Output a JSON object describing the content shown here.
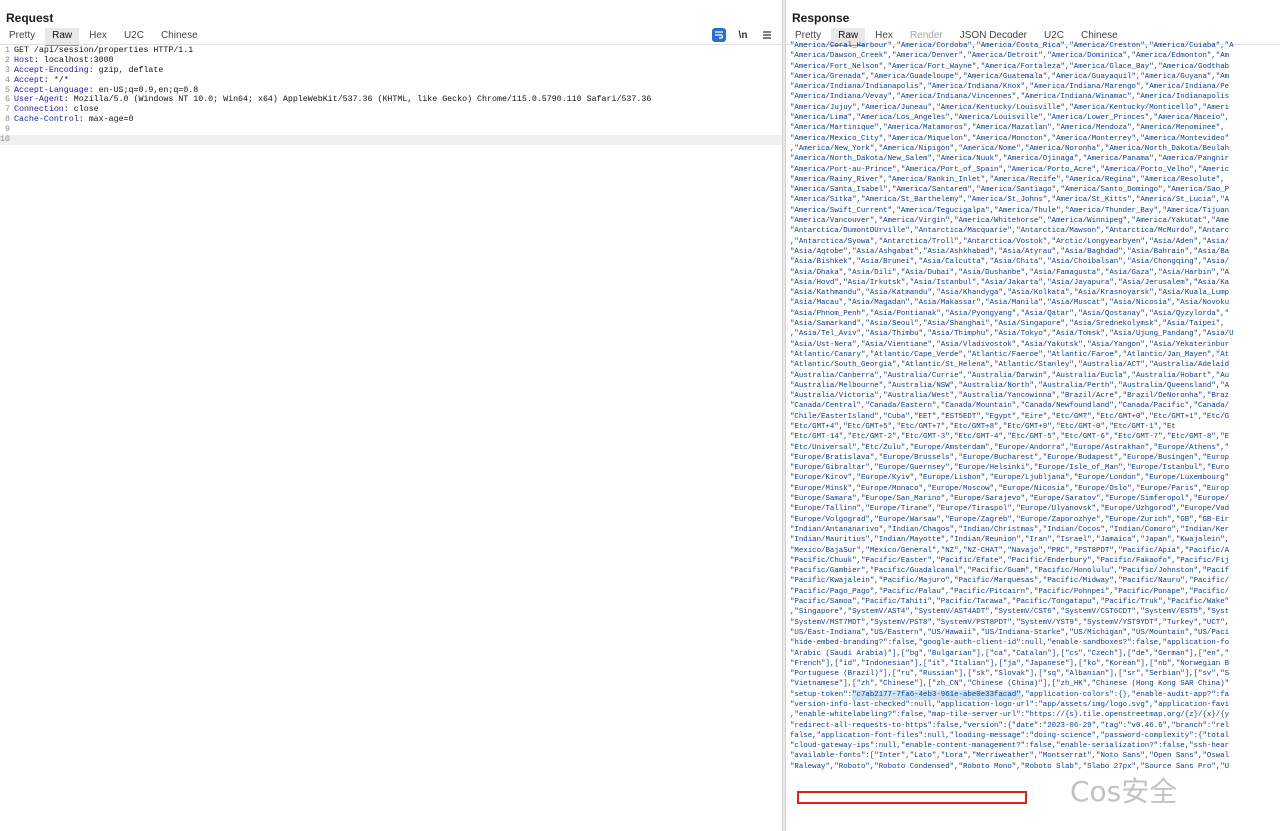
{
  "request": {
    "title": "Request",
    "tabs": [
      {
        "label": "Pretty",
        "active": false
      },
      {
        "label": "Raw",
        "active": true
      },
      {
        "label": "Hex",
        "active": false
      },
      {
        "label": "U2C",
        "active": false
      },
      {
        "label": "Chinese",
        "active": false
      }
    ],
    "toolbar": {
      "newline_label": "\\n"
    },
    "lines": [
      {
        "num": "1",
        "text": "GET /api/session/properties HTTP/1.1"
      },
      {
        "num": "2",
        "key": "Host",
        "value": ": localhost:3000"
      },
      {
        "num": "3",
        "key": "Accept-Encoding",
        "value": ": gzip, deflate"
      },
      {
        "num": "4",
        "key": "Accept",
        "value": ": */*"
      },
      {
        "num": "5",
        "key": "Accept-Language",
        "value": ": en-US;q=0.9,en;q=0.8"
      },
      {
        "num": "6",
        "key": "User-Agent",
        "value": ": Mozilla/5.0 (Windows NT 10.0; Win64; x64) AppleWebKit/537.36 (KHTML, like Gecko) Chrome/115.0.5790.110 Safari/537.36"
      },
      {
        "num": "7",
        "key": "Connection",
        "value": ": close"
      },
      {
        "num": "8",
        "key": "Cache-Control",
        "value": ": max-age=0"
      },
      {
        "num": "9",
        "text": ""
      },
      {
        "num": "10",
        "text": ""
      }
    ]
  },
  "response": {
    "title": "Response",
    "tabs": [
      {
        "label": "Pretty",
        "active": false
      },
      {
        "label": "Raw",
        "active": true
      },
      {
        "label": "Hex",
        "active": false
      },
      {
        "label": "Render",
        "active": false
      },
      {
        "label": "JSON Decoder",
        "active": false
      },
      {
        "label": "U2C",
        "active": false
      },
      {
        "label": "Chinese",
        "active": false
      }
    ],
    "lines": [
      "\"America/Coral_Harbour\",\"America/Cordoba\",\"America/Costa_Rica\",\"America/Creston\",\"America/Cuiaba\",\"A",
      "\"America/Dawson_Creek\",\"America/Denver\",\"America/Detroit\",\"America/Dominica\",\"America/Edmonton\",\"Am",
      "\"America/Fort_Nelson\",\"America/Fort_Wayne\",\"America/Fortaleza\",\"America/Glace_Bay\",\"America/Godthab",
      "\"America/Grenada\",\"America/Guadeloupe\",\"America/Guatemala\",\"America/Guayaquil\",\"America/Guyana\",\"Am",
      "\"America/Indiana/Indianapolis\",\"America/Indiana/Knox\",\"America/Indiana/Marengo\",\"America/Indiana/Pe",
      "\"America/Indiana/Vevay\",\"America/Indiana/Vincennes\",\"America/Indiana/Winamac\",\"America/Indianapolis",
      "\"America/Jujuy\",\"America/Juneau\",\"America/Kentucky/Louisville\",\"America/Kentucky/Monticello\",\"Ameri",
      "\"America/Lima\",\"America/Los_Angeles\",\"America/Louisville\",\"America/Lower_Princes\",\"America/Maceio\",",
      "\"America/Martinique\",\"America/Matamoros\",\"America/Mazatlan\",\"America/Mendoza\",\"America/Menominee\",",
      "\"America/Mexico_City\",\"America/Miquelon\",\"America/Moncton\",\"America/Monterrey\",\"America/Montevideo\"",
      ",\"America/New_York\",\"America/Nipigon\",\"America/Nome\",\"America/Noronha\",\"America/North_Dakota/Beulah",
      "\"America/North_Dakota/New_Salem\",\"America/Nuuk\",\"America/Ojinaga\",\"America/Panama\",\"America/Pangnir",
      "\"America/Port-au-Prince\",\"America/Port_of_Spain\",\"America/Porto_Acre\",\"America/Porto_Velho\",\"Americ",
      "\"America/Rainy_River\",\"America/Rankin_Inlet\",\"America/Recife\",\"America/Regina\",\"America/Resolute\",",
      "\"America/Santa_Isabel\",\"America/Santarem\",\"America/Santiago\",\"America/Santo_Domingo\",\"America/Sao_P",
      "\"America/Sitka\",\"America/St_Barthelemy\",\"America/St_Johns\",\"America/St_Kitts\",\"America/St_Lucia\",\"A",
      "\"America/Swift_Current\",\"America/Tegucigalpa\",\"America/Thule\",\"America/Thunder_Bay\",\"America/Tijuan",
      "\"America/Vancouver\",\"America/Virgin\",\"America/Whitehorse\",\"America/Winnipeg\",\"America/Yakutat\",\"Ame",
      "\"Antarctica/DumontDUrville\",\"Antarctica/Macquarie\",\"Antarctica/Mawson\",\"Antarctica/McMurdo\",\"Antarc",
      ",\"Antarctica/Syowa\",\"Antarctica/Troll\",\"Antarctica/Vostok\",\"Arctic/Longyearbyen\",\"Asia/Aden\",\"Asia/",
      "\"Asia/Aqtobe\",\"Asia/Ashgabat\",\"Asia/Ashkhabad\",\"Asia/Atyrau\",\"Asia/Baghdad\",\"Asia/Bahrain\",\"Asia/Ba",
      "\"Asia/Bishkek\",\"Asia/Brunei\",\"Asia/Calcutta\",\"Asia/Chita\",\"Asia/Choibalsan\",\"Asia/Chongqing\",\"Asia/",
      "\"Asia/Dhaka\",\"Asia/Dili\",\"Asia/Dubai\",\"Asia/Dushanbe\",\"Asia/Famagusta\",\"Asia/Gaza\",\"Asia/Harbin\",\"A",
      "\"Asia/Hovd\",\"Asia/Irkutsk\",\"Asia/Istanbul\",\"Asia/Jakarta\",\"Asia/Jayapura\",\"Asia/Jerusalem\",\"Asia/Ka",
      "\"Asia/Kathmandu\",\"Asia/Katmandu\",\"Asia/Khandyga\",\"Asia/Kolkata\",\"Asia/Krasnoyarsk\",\"Asia/Kuala_Lump",
      "\"Asia/Macau\",\"Asia/Magadan\",\"Asia/Makassar\",\"Asia/Manila\",\"Asia/Muscat\",\"Asia/Nicosia\",\"Asia/Novoku",
      "\"Asia/Phnom_Penh\",\"Asia/Pontianak\",\"Asia/Pyongyang\",\"Asia/Qatar\",\"Asia/Qostanay\",\"Asia/Qyzylorda\",\"",
      "\"Asia/Samarkand\",\"Asia/Seoul\",\"Asia/Shanghai\",\"Asia/Singapore\",\"Asia/Srednekolymsk\",\"Asia/Taipei\",",
      ",\"Asia/Tel_Aviv\",\"Asia/Thimbu\",\"Asia/Thimphu\",\"Asia/Tokyo\",\"Asia/Tomsk\",\"Asia/Ujung_Pandang\",\"Asia/U",
      "\"Asia/Ust-Nera\",\"Asia/Vientiane\",\"Asia/Vladivostok\",\"Asia/Yakutsk\",\"Asia/Yangon\",\"Asia/Yekaterinbur",
      "\"Atlantic/Canary\",\"Atlantic/Cape_Verde\",\"Atlantic/Faeroe\",\"Atlantic/Faroe\",\"Atlantic/Jan_Mayen\",\"At",
      "\"Atlantic/South_Georgia\",\"Atlantic/St_Helena\",\"Atlantic/Stanley\",\"Australia/ACT\",\"Australia/Adelaid",
      "\"Australia/Canberra\",\"Australia/Currie\",\"Australia/Darwin\",\"Australia/Eucla\",\"Australia/Hobart\",\"Au",
      "\"Australia/Melbourne\",\"Australia/NSW\",\"Australia/North\",\"Australia/Perth\",\"Australia/Queensland\",\"A",
      "\"Australia/Victoria\",\"Australia/West\",\"Australia/Yancowinna\",\"Brazil/Acre\",\"Brazil/DeNoronha\",\"Braz",
      "\"Canada/Central\",\"Canada/Eastern\",\"Canada/Mountain\",\"Canada/Newfoundland\",\"Canada/Pacific\",\"Canada/",
      "\"Chile/EasterIsland\",\"Cuba\",\"EET\",\"EST5EDT\",\"Egypt\",\"Eire\",\"Etc/GMT\",\"Etc/GMT+0\",\"Etc/GMT+1\",\"Etc/G",
      "\"Etc/GMT+4\",\"Etc/GMT+5\",\"Etc/GMT+7\",\"Etc/GMT+8\",\"Etc/GMT+9\",\"Etc/GMT-0\",\"Etc/GMT-1\",\"Et",
      "\"Etc/GMT-14\",\"Etc/GMT-2\",\"Etc/GMT-3\",\"Etc/GMT-4\",\"Etc/GMT-5\",\"Etc/GMT-6\",\"Etc/GMT-7\",\"Etc/GMT-8\",\"E",
      "\"Etc/Universal\",\"Etc/Zulu\",\"Europe/Amsterdam\",\"Europe/Andorra\",\"Europe/Astrakhan\",\"Europe/Athens\",\"",
      "\"Europe/Bratislava\",\"Europe/Brussels\",\"Europe/Bucharest\",\"Europe/Budapest\",\"Europe/Busingen\",\"Europ",
      "\"Europe/Gibraltar\",\"Europe/Guernsey\",\"Europe/Helsinki\",\"Europe/Isle_of_Man\",\"Europe/Istanbul\",\"Euro",
      "\"Europe/Kirov\",\"Europe/Kyiv\",\"Europe/Lisbon\",\"Europe/Ljubljana\",\"Europe/London\",\"Europe/Luxembourg\"",
      "\"Europe/Minsk\",\"Europe/Monaco\",\"Europe/Moscow\",\"Europe/Nicosia\",\"Europe/Oslo\",\"Europe/Paris\",\"Europ",
      "\"Europe/Samara\",\"Europe/San_Marino\",\"Europe/Sarajevo\",\"Europe/Saratov\",\"Europe/Simferopol\",\"Europe/",
      "\"Europe/Tallinn\",\"Europe/Tirane\",\"Europe/Tiraspol\",\"Europe/Ulyanovsk\",\"Europe/Uzhgorod\",\"Europe/Vad",
      "\"Europe/Volgograd\",\"Europe/Warsaw\",\"Europe/Zagreb\",\"Europe/Zaporozhye\",\"Europe/Zurich\",\"GB\",\"GB-Eir",
      "\"Indian/Antananarivo\",\"Indian/Chagos\",\"Indian/Christmas\",\"Indian/Cocos\",\"Indian/Comoro\",\"Indian/Ker",
      "\"Indian/Mauritius\",\"Indian/Mayotte\",\"Indian/Reunion\",\"Iran\",\"Israel\",\"Jamaica\",\"Japan\",\"Kwajalein\",",
      "\"Mexico/BajaSur\",\"Mexico/General\",\"NZ\",\"NZ-CHAT\",\"Navajo\",\"PRC\",\"PST8PDT\",\"Pacific/Apia\",\"Pacific/A",
      "\"Pacific/Chuuk\",\"Pacific/Easter\",\"Pacific/Efate\",\"Pacific/Enderbury\",\"Pacific/Fakaofo\",\"Pacific/Fij",
      "\"Pacific/Gambier\",\"Pacific/Guadalcanal\",\"Pacific/Guam\",\"Pacific/Honolulu\",\"Pacific/Johnston\",\"Pacif",
      "\"Pacific/Kwajalein\",\"Pacific/Majuro\",\"Pacific/Marquesas\",\"Pacific/Midway\",\"Pacific/Nauru\",\"Pacific/",
      "\"Pacific/Pago_Pago\",\"Pacific/Palau\",\"Pacific/Pitcairn\",\"Pacific/Pohnpei\",\"Pacific/Ponape\",\"Pacific/",
      "\"Pacific/Samoa\",\"Pacific/Tahiti\",\"Pacific/Tarawa\",\"Pacific/Tongatapu\",\"Pacific/Truk\",\"Pacific/Wake\"",
      ",\"Singapore\",\"SystemV/AST4\",\"SystemV/AST4ADT\",\"SystemV/CST6\",\"SystemV/CST6CDT\",\"SystemV/EST5\",\"Syst",
      "\"SystemV/MST7MDT\",\"SystemV/PST8\",\"SystemV/PST8PDT\",\"SystemV/YST9\",\"SystemV/YST9YDT\",\"Turkey\",\"UCT\",",
      "\"US/East-Indiana\",\"US/Eastern\",\"US/Hawaii\",\"US/Indiana-Starke\",\"US/Michigan\",\"US/Mountain\",\"US/Paci",
      "\"hide-embed-branding?\":false,\"google-auth-client-id\":null,\"enable-sandboxes?\":false,\"application-fo",
      "\"Arabic (Saudi Arabia)\"],[\"bg\",\"Bulgarian\"],[\"ca\",\"Catalan\"],[\"cs\",\"Czech\"],[\"de\",\"German\"],[\"en\",\"",
      "\"French\"],[\"id\",\"Indonesian\"],[\"it\",\"Italian\"],[\"ja\",\"Japanese\"],[\"ko\",\"Korean\"],[\"nb\",\"Norwegian B",
      "\"Portuguese (Brazil)\"],[\"ru\",\"Russian\"],[\"sk\",\"Slovak\"],[\"sq\",\"Albanian\"],[\"sr\",\"Serbian\"],[\"sv\",\"S",
      "\"Vietnamese\"],[\"zh\",\"Chinese\"],[\"zh_CN\",\"Chinese (China)\"],[\"zh_HK\",\"Chinese (Hong Kong SAR China)\"",
      "",
      "\"version-info-last-checked\":null,\"application-logo-url\":\"app/assets/img/logo.svg\",\"application-favi",
      ",\"enable-whitelabeling?\":false,\"map-tile-server-url\":\"https://{s}.tile.openstreetmap.org/{z}/{x}/{y",
      "\"redirect-all-requests-to-https\":false,\"version\":{\"date\":\"2023-06-29\",\"tag\":\"v0.46.6\",\"branch\":\"rel",
      "false,\"application-font-files\":null,\"loading-message\":\"doing-science\",\"password-complexity\":{\"total",
      "\"cloud-gateway-ips\":null,\"enable-content-management?\":false,\"enable-serialization?\":false,\"ssh-hear",
      "\"available-fonts\":[\"Inter\",\"Lato\",\"Lora\",\"Merriweather\",\"Montserrat\",\"Noto Sans\",\"Open Sans\",\"Oswal",
      "\"Raleway\",\"Roboto\",\"Roboto Condensed\",\"Roboto Mono\",\"Roboto Slab\",\"Slabo 27px\",\"Source Sans Pro\",\"U"
    ],
    "token_line": {
      "key": "\"setup-token\":",
      "token": "\"c7ab2177-7fa6-4eb3-961e-abe0e33facad\"",
      "rest": ",\"application-colors\":{},\"enable-audit-app?\":fa"
    },
    "watermark": "Cos安全"
  }
}
